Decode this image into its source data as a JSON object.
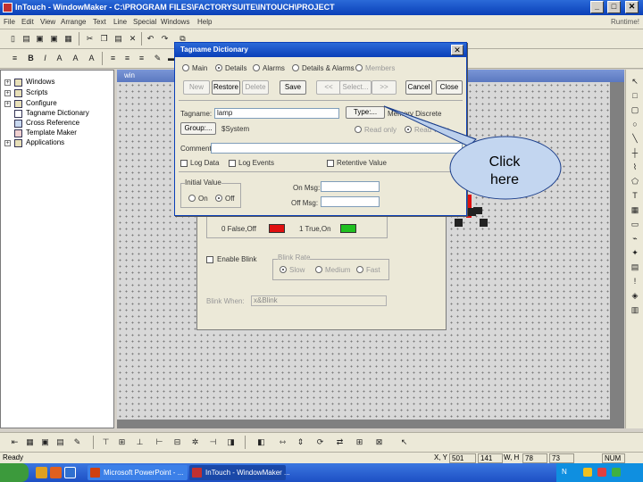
{
  "app": {
    "title": "InTouch - WindowMaker - C:\\PROGRAM FILES\\FACTORYSUITE\\INTOUCH\\PROJECT",
    "menu": [
      "File",
      "Edit",
      "View",
      "Arrange",
      "Text",
      "Line",
      "Special",
      "Windows",
      "Help"
    ],
    "menu_right": "Runtime!"
  },
  "tree": {
    "items": [
      "Windows",
      "Scripts",
      "Configure",
      "Tagname Dictionary",
      "Cross Reference",
      "Template Maker",
      "Applications"
    ]
  },
  "window": {
    "title": "win"
  },
  "dialog": {
    "title": "Tagname Dictionary",
    "modes": [
      "Main",
      "Details",
      "Alarms",
      "Details & Alarms",
      "Members"
    ],
    "selected_mode": "Details",
    "buttons": [
      "New",
      "Restore",
      "Delete",
      "Save",
      "<<",
      "Select...",
      ">>",
      "Cancel",
      "Close"
    ],
    "tagname_label": "Tagname:",
    "tagname_value": "lamp",
    "type_button": "Type:...",
    "type_value": "Memory Discrete",
    "group_button": "Group:...",
    "group_value": "$System",
    "read_only": "Read only",
    "read_write": "Read Write",
    "comment_label": "Comment:",
    "log_data": "Log Data",
    "log_events": "Log Events",
    "retentive_value": "Retentive Value",
    "initial_value_label": "Initial Value",
    "initial_on": "On",
    "initial_off": "Off",
    "on_msg_label": "On Msg:",
    "off_msg_label": "Off Msg:"
  },
  "lamp_dialog": {
    "false_label": "0 False,Off",
    "true_label": "1 True,On",
    "false_color": "#e01010",
    "true_color": "#20c020",
    "enable_blink": "Enable Blink",
    "blink_rate_label": "Blink Rate",
    "blink_rates": [
      "Slow",
      "Medium",
      "Fast"
    ],
    "blink_when_label": "Blink When:",
    "blink_when_value": "x&Blink"
  },
  "callout": {
    "text_line1": "Click",
    "text_line2": "here"
  },
  "status": {
    "ready": "Ready",
    "xy_label": "X, Y",
    "x": "501",
    "y": "141",
    "wh_label": "W, H",
    "w": "78",
    "h": "73",
    "num": "NUM"
  },
  "taskbar": {
    "tasks": [
      "Microsoft PowerPoint - ...",
      "InTouch - WindowMaker ..."
    ],
    "tray_text": "N"
  }
}
